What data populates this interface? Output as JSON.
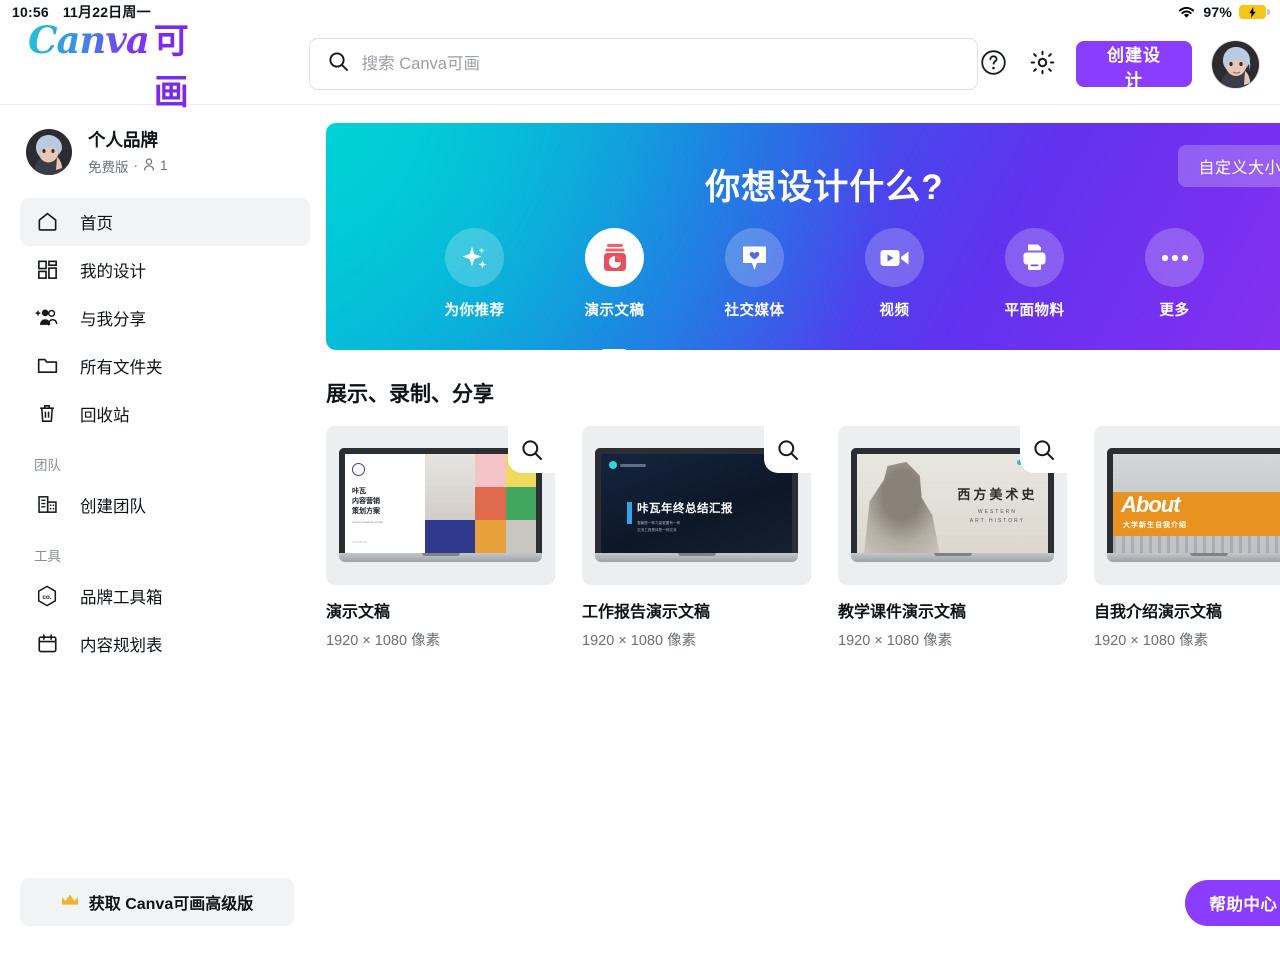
{
  "status_bar": {
    "time": "10:56",
    "date": "11月22日周一",
    "battery_percent": "97%",
    "wifi_icon": "wifi-icon",
    "battery_icon": "battery-charging-icon"
  },
  "header": {
    "logo_latin": "Canva",
    "logo_cn": "可画",
    "search": {
      "placeholder": "搜索 Canva可画",
      "value": "",
      "icon": "search-icon"
    },
    "help_icon": "question-circle-icon",
    "settings_icon": "gear-icon",
    "create_button": "创建设计",
    "avatar": "user-avatar"
  },
  "sidebar": {
    "profile": {
      "name": "个人品牌",
      "plan": "免费版",
      "separator": "·",
      "member_count": "1",
      "member_icon": "person-icon"
    },
    "items": [
      {
        "label": "首页",
        "icon": "home-icon",
        "active": true
      },
      {
        "label": "我的设计",
        "icon": "grid-icon",
        "active": false
      },
      {
        "label": "与我分享",
        "icon": "share-people-icon",
        "active": false
      },
      {
        "label": "所有文件夹",
        "icon": "folder-icon",
        "active": false
      },
      {
        "label": "回收站",
        "icon": "trash-icon",
        "active": false
      }
    ],
    "group_team": {
      "label": "团队",
      "items": [
        {
          "label": "创建团队",
          "icon": "building-icon"
        }
      ]
    },
    "group_tools": {
      "label": "工具",
      "items": [
        {
          "label": "品牌工具箱",
          "icon": "brand-hexagon-icon"
        },
        {
          "label": "内容规划表",
          "icon": "calendar-icon"
        }
      ]
    },
    "premium": {
      "label": "获取 Canva可画高级版",
      "icon": "crown-icon"
    }
  },
  "banner": {
    "title": "你想设计什么?",
    "custom_size_button": "自定义大小",
    "categories": [
      {
        "label": "为你推荐",
        "icon": "sparkle-icon",
        "active": false
      },
      {
        "label": "演示文稿",
        "icon": "presentation-pie-icon",
        "active": true
      },
      {
        "label": "社交媒体",
        "icon": "heart-bubble-icon",
        "active": false
      },
      {
        "label": "视频",
        "icon": "video-camera-icon",
        "active": false
      },
      {
        "label": "平面物料",
        "icon": "printer-icon",
        "active": false
      },
      {
        "label": "更多",
        "icon": "ellipsis-icon",
        "active": false
      }
    ],
    "colors": {
      "start": "#00b7d4",
      "mid": "#2b5fe8",
      "end": "#8a2ff0"
    }
  },
  "content": {
    "section_title": "展示、录制、分享",
    "cards": [
      {
        "title": "演示文稿",
        "size": "1920 × 1080 像素",
        "zoom_icon": "magnifier-icon",
        "art": {
          "headline": "咔瓦\n内容营销\n策划方案",
          "sub": "Content Marketing Plan",
          "footer": "2023.06.05"
        }
      },
      {
        "title": "工作报告演示文稿",
        "size": "1920 × 1080 像素",
        "zoom_icon": "magnifier-icon",
        "art": {
          "headline": "咔瓦年终总结汇报",
          "sub": "凝聚是一种力量更要有一种\n交流工具是体是一种交流"
        }
      },
      {
        "title": "教学课件演示文稿",
        "size": "1920 × 1080 像素",
        "zoom_icon": "magnifier-icon",
        "art": {
          "headline": "西方美术史",
          "sub": "WESTERN",
          "sub2": "ART HISTORY"
        }
      },
      {
        "title": "自我介绍演示文稿",
        "size": "1920 × 1080 像素",
        "zoom_icon": "",
        "art": {
          "headline": "About",
          "sub": "大学新生自我介绍"
        }
      }
    ],
    "next_button_icon": "chevron-right-icon"
  },
  "help": {
    "label": "帮助中心",
    "mark": "?"
  }
}
